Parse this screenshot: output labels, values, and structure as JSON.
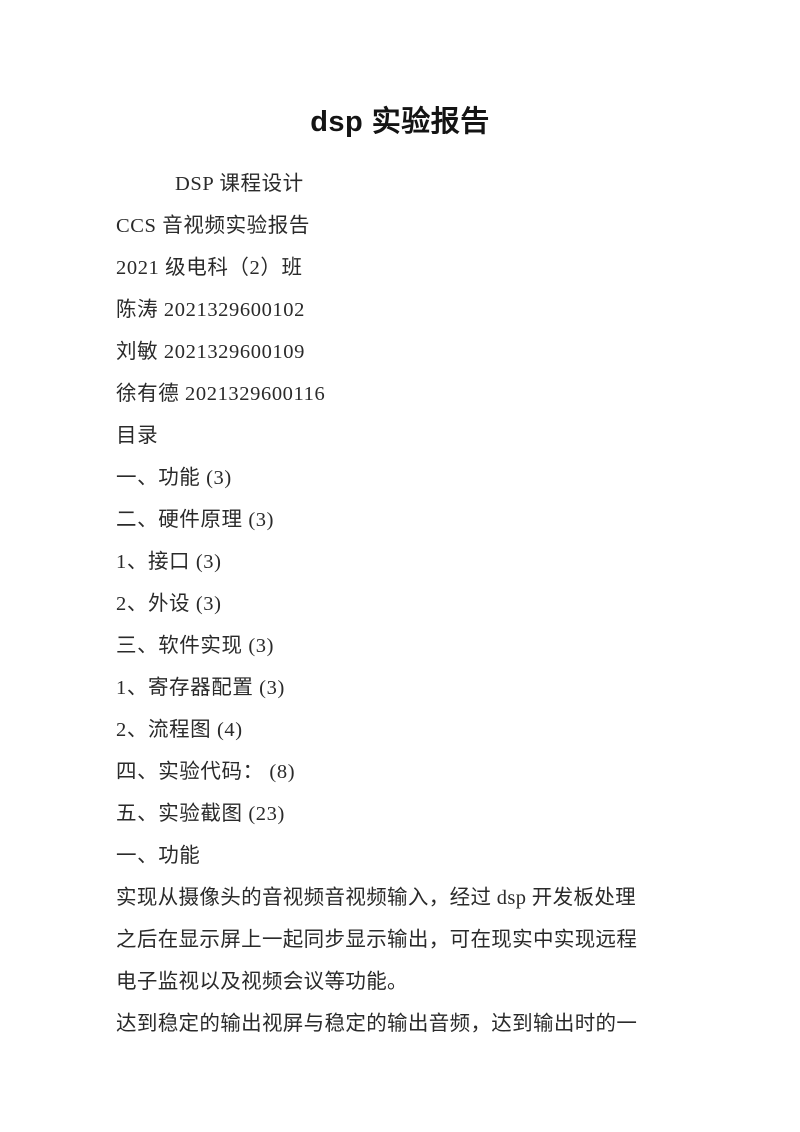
{
  "document": {
    "title": "dsp 实验报告",
    "cover": {
      "course": "DSP 课程设计",
      "report_name": "CCS 音视频实验报告",
      "class": "2021 级电科（2）班",
      "authors": [
        "陈涛 2021329600102",
        "刘敏 2021329600109",
        "徐有德 2021329600116"
      ]
    },
    "toc": {
      "heading": "目录",
      "entries": [
        "一、功能 (3)",
        "二、硬件原理 (3)",
        "1、接口 (3)",
        "2、外设 (3)",
        "三、软件实现 (3)",
        "1、寄存器配置 (3)",
        "2、流程图 (4)",
        "四、实验代码： (8)",
        "五、实验截图 (23)"
      ]
    },
    "sections": [
      {
        "heading": "一、功能",
        "paragraph_lines": [
          "实现从摄像头的音视频音视频输入，经过 dsp 开发板处理",
          "之后在显示屏上一起同步显示输出，可在现实中实现远程",
          "电子监视以及视频会议等功能。",
          "达到稳定的输出视屏与稳定的输出音频，达到输出时的一"
        ]
      }
    ]
  }
}
